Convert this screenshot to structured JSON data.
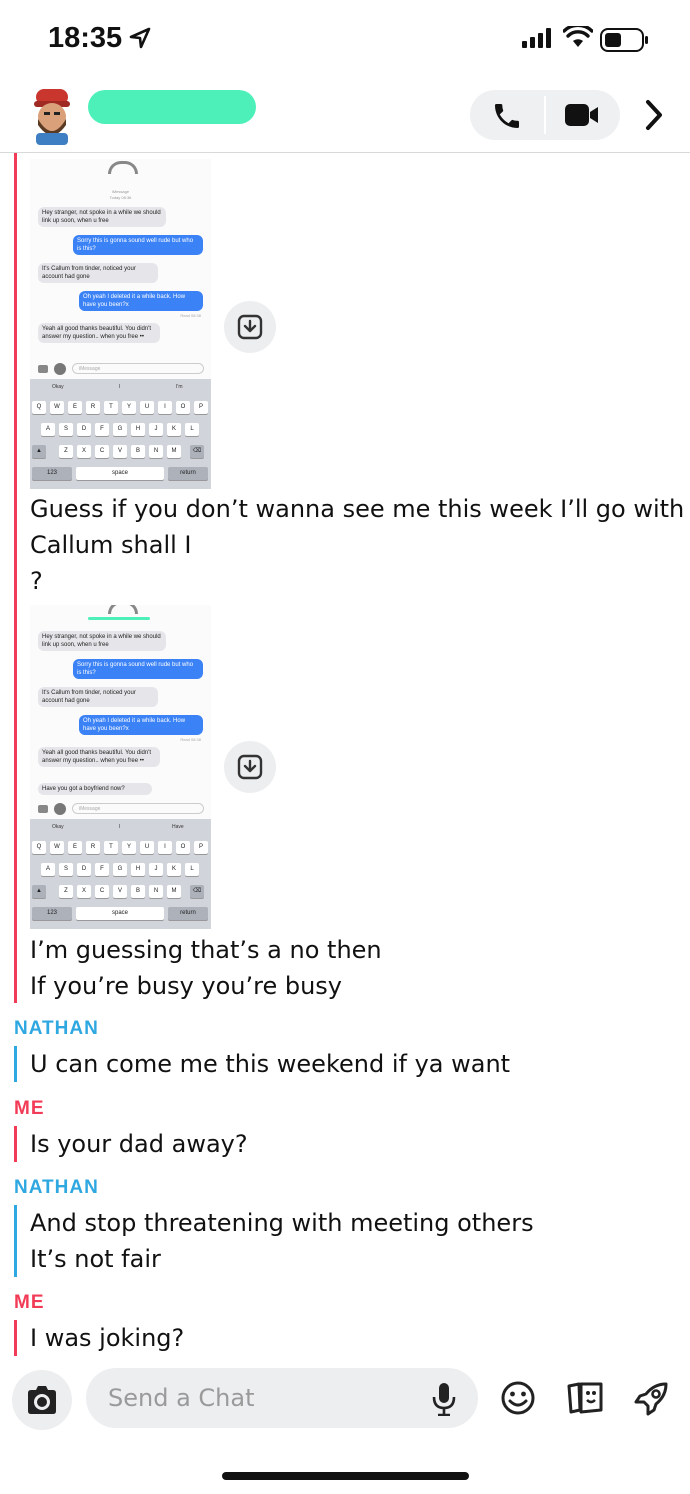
{
  "status": {
    "time": "18:35"
  },
  "header": {
    "avatar_icon": "bitmoji-avatar",
    "call_icon": "phone-icon",
    "video_icon": "video-icon",
    "more_icon": "chevron-right-icon"
  },
  "screenshot1": {
    "title": "iMessage",
    "date": "Today 08:36",
    "msgs": [
      {
        "side": "l",
        "text": "Hey stranger, not spoke in a while we should link up soon, when u free"
      },
      {
        "side": "r",
        "text": "Sorry this is gonna sound well rude but who is this?"
      },
      {
        "side": "l",
        "text": "It's Callum from tinder, noticed your account had gone"
      },
      {
        "side": "r",
        "text": "Oh yeah I deleted it a while back. How have you been?x"
      },
      {
        "side": "l",
        "text": "Yeah all good thanks beautiful. You didn't answer my question.. when you free ••"
      }
    ],
    "read": "Read 08:38",
    "input_placeholder": "iMessage",
    "suggestions": [
      "Okay",
      "I",
      "I'm"
    ]
  },
  "screenshot2": {
    "msgs": [
      {
        "side": "l",
        "text": "Hey stranger, not spoke in a while we should link up soon, when u free"
      },
      {
        "side": "r",
        "text": "Sorry this is gonna sound well rude but who is this?"
      },
      {
        "side": "l",
        "text": "It's Callum from tinder, noticed your account had gone"
      },
      {
        "side": "r",
        "text": "Oh yeah I deleted it a while back. How have you been?x"
      },
      {
        "side": "l",
        "text": "Yeah all good thanks beautiful. You didn't answer my question.. when you free ••"
      },
      {
        "side": "l",
        "text": "Have you got a boyfriend now?"
      }
    ],
    "read": "Read 08:38",
    "input_placeholder": "iMessage",
    "suggestions": [
      "Okay",
      "I",
      "Have"
    ]
  },
  "keyboard": {
    "row1": [
      "Q",
      "W",
      "E",
      "R",
      "T",
      "Y",
      "U",
      "I",
      "O",
      "P"
    ],
    "row2": [
      "A",
      "S",
      "D",
      "F",
      "G",
      "H",
      "J",
      "K",
      "L"
    ],
    "row3": [
      "Z",
      "X",
      "C",
      "V",
      "B",
      "N",
      "M"
    ],
    "num": "123",
    "space": "space",
    "ret": "return"
  },
  "messages": {
    "m1_l1": "Guess if you don’t wanna see me this week I’ll go with",
    "m1_l2": "Callum shall I",
    "m1_l3": "?",
    "m2_l1": "I’m guessing that’s a no then",
    "m2_l2": "If you’re busy you’re busy",
    "s_nathan1": "NATHAN",
    "n1": "U can come me this weekend if ya want",
    "s_me1": "ME",
    "me1": "Is your dad away?",
    "s_nathan2": "NATHAN",
    "n2_l1": "And stop threatening with meeting others",
    "n2_l2": "It’s not fair",
    "s_me2": "ME",
    "me2": "I was joking?"
  },
  "composer": {
    "placeholder": "Send a Chat",
    "icons": [
      "camera-icon",
      "mic-icon",
      "emoji-icon",
      "stickers-icon",
      "games-rocket-icon"
    ]
  }
}
